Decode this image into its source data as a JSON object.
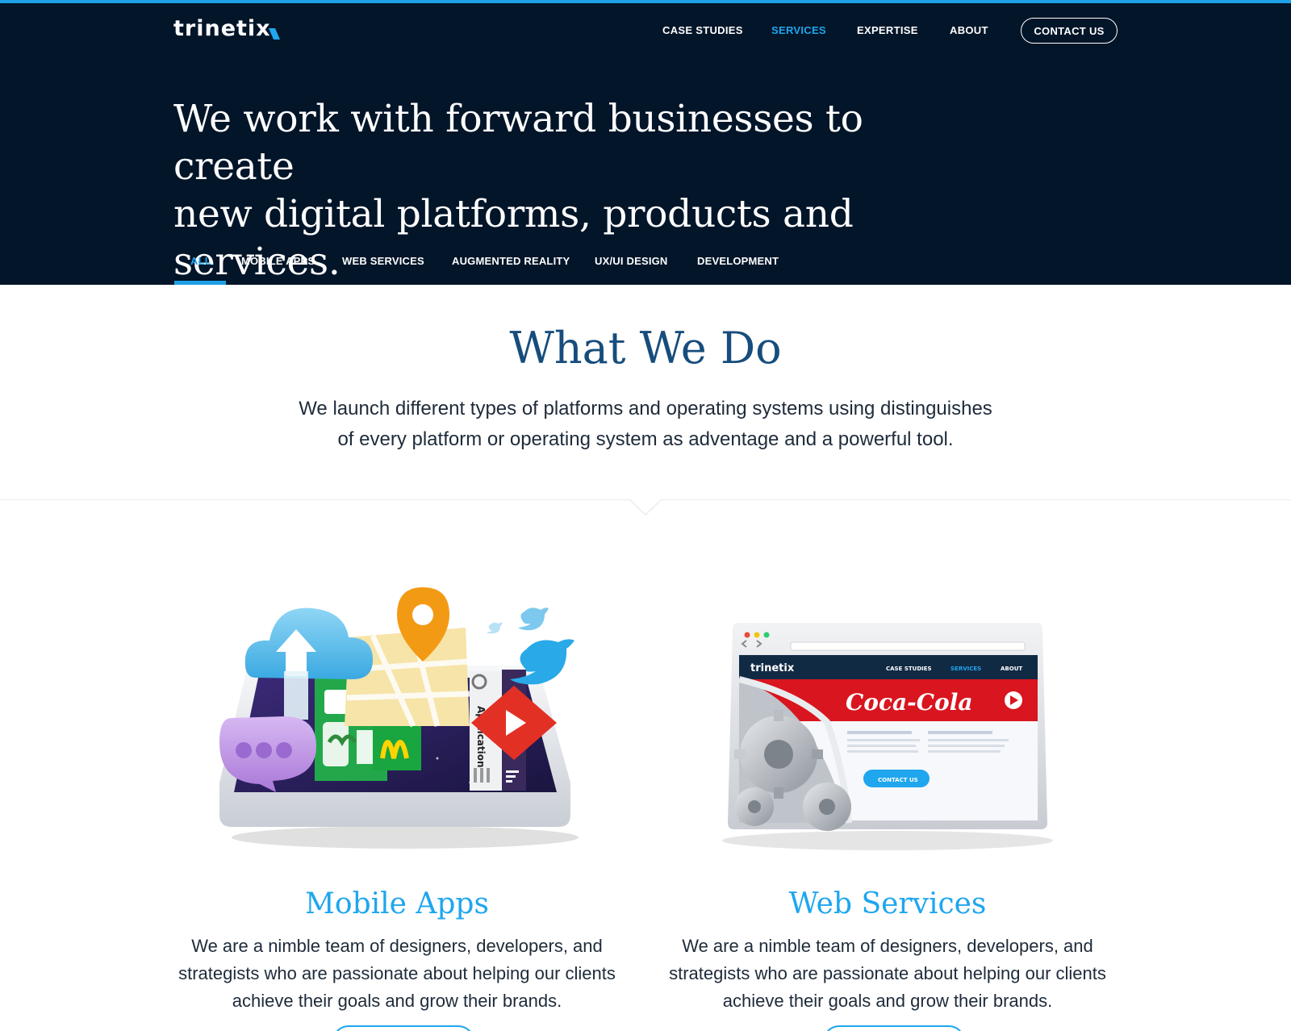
{
  "header": {
    "logo_text": "trinetix",
    "nav": [
      {
        "label": "CASE STUDIES",
        "active": false
      },
      {
        "label": "SERVICES",
        "active": true
      },
      {
        "label": "EXPERTISE",
        "active": false
      },
      {
        "label": "ABOUT",
        "active": false
      }
    ],
    "contact_label": "CONTACT US"
  },
  "hero": {
    "title_line1": "We work with forward businesses to create",
    "title_line2": "new digital platforms, products and services."
  },
  "filters": [
    {
      "label": "ALL",
      "active": true
    },
    {
      "label": "MOBILE APPS",
      "active": false
    },
    {
      "label": "WEB SERVICES",
      "active": false
    },
    {
      "label": "AUGMENTED REALITY",
      "active": false
    },
    {
      "label": "UX/UI DESIGN",
      "active": false
    },
    {
      "label": "DEVELOPMENT",
      "active": false
    }
  ],
  "what_we_do": {
    "title": "What We Do",
    "desc_line1": "We launch different types of platforms and operating systems using distinguishes",
    "desc_line2": "of every platform or operating system as adventage and a powerful tool."
  },
  "services": [
    {
      "title": "Mobile Apps",
      "desc_line1": "We are a nimble team of designers, developers, and",
      "desc_line2": "strategists who are passionate about helping our clients",
      "desc_line3": "achieve their goals and grow their brands.",
      "illustration_text": "Application"
    },
    {
      "title": "Web Services",
      "desc_line1": "We are a nimble team of designers, developers, and",
      "desc_line2": "strategists who are passionate about helping our clients",
      "desc_line3": "achieve their goals and grow their brands.",
      "screen": {
        "logo": "trinetix",
        "nav": [
          "CASE STUDIES",
          "SERVICES",
          "ABOUT"
        ],
        "banner_brand": "Coca-Cola",
        "button": "CONTACT US"
      }
    }
  ],
  "colors": {
    "hero_bg": "#031529",
    "accent": "#1fa6ee",
    "heading_dark_blue": "#174d7d",
    "text": "#1e2b3a"
  }
}
